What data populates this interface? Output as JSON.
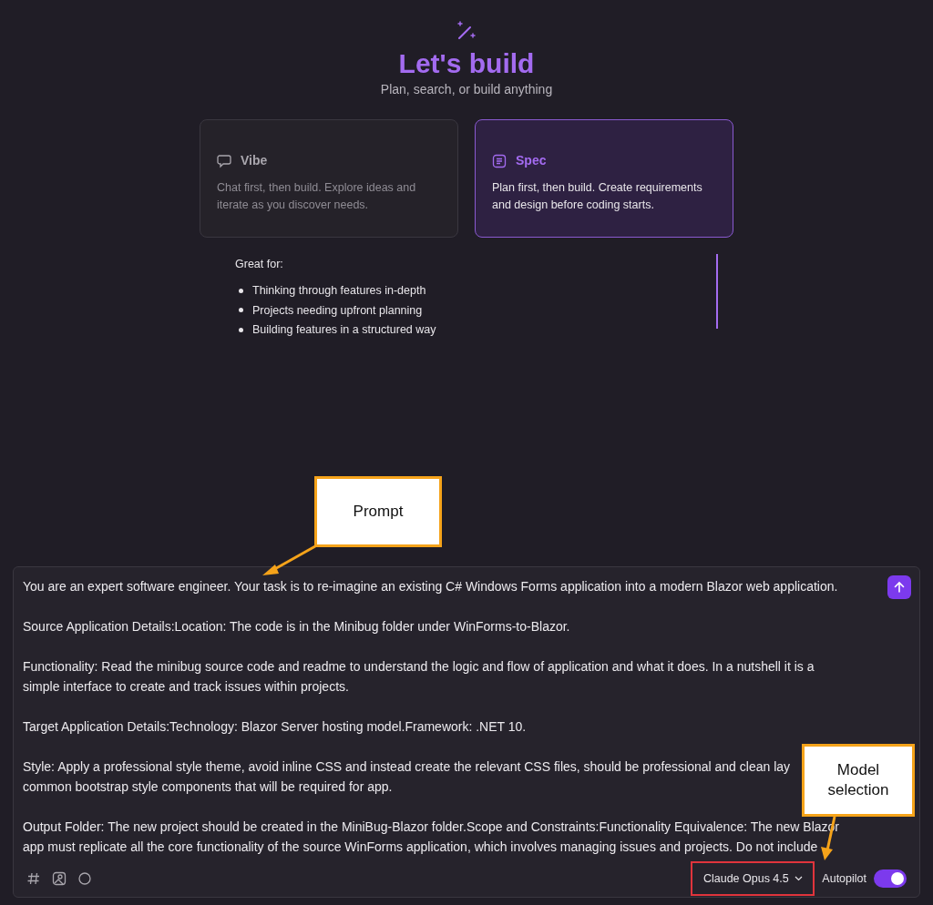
{
  "header": {
    "title": "Let's build",
    "subtitle": "Plan, search, or build anything"
  },
  "modes": [
    {
      "kind": "chat",
      "title": "Vibe",
      "description": "Chat first, then build. Explore ideas and iterate as you discover needs.",
      "selected": false
    },
    {
      "kind": "spec",
      "title": "Spec",
      "description": "Plan first, then build. Create requirements and design before coding starts.",
      "selected": true
    }
  ],
  "details": {
    "heading": "Great for:",
    "items": [
      "Thinking through features in-depth",
      "Projects needing upfront planning",
      "Building features in a structured way"
    ]
  },
  "prompt": {
    "paragraphs": [
      [
        "You are an expert software engineer. Your task is to re-imagine an existing C# Windows Forms application into a modern Blazor web application."
      ],
      [
        "Source Application Details:Location: The code is in the Minibug folder under WinForms-to-Blazor."
      ],
      [
        "Functionality: Read the minibug source code and readme to understand the logic and flow of application and what it does. In a nutshell it is a",
        "simple interface to create and track issues within projects."
      ],
      [
        "Target Application Details:Technology: Blazor Server hosting model.Framework: .NET 10."
      ],
      [
        "Style: Apply a professional style theme, avoid inline CSS and instead create the relevant CSS files, should be professional and clean lay",
        "common bootstrap style components that will be required for app."
      ],
      [
        "Output Folder: The new project should be created in the MiniBug-Blazor folder.Scope and Constraints:Functionality Equivalence: The new Blazor",
        "app must replicate all the core functionality of the source WinForms application, which involves managing issues and projects. Do not include"
      ]
    ]
  },
  "toolbar": {
    "model": "Claude Opus 4.5",
    "autopilot": {
      "label": "Autopilot",
      "on": true
    }
  },
  "annotations": {
    "prompt_callout": "Prompt",
    "model_callout": "Model selection"
  }
}
